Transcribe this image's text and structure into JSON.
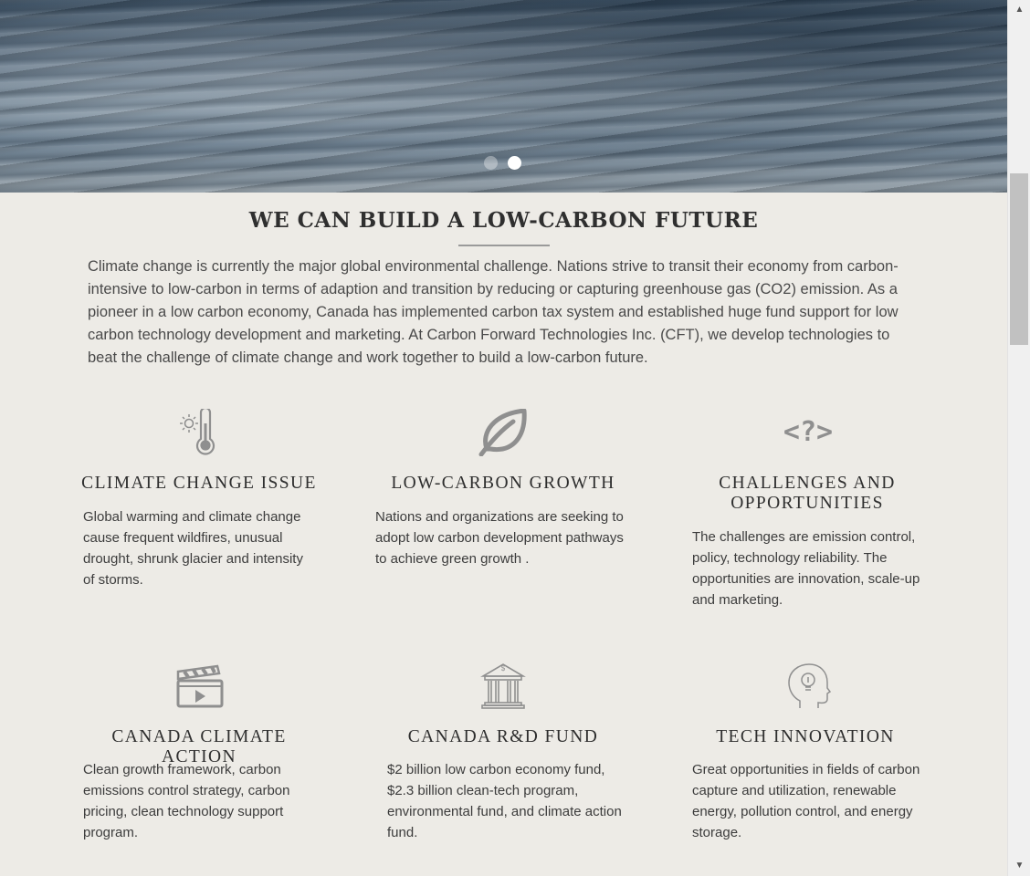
{
  "hero": {
    "slide_count": 2,
    "active_slide": 2
  },
  "section": {
    "title": "WE CAN BUILD A  LOW-CARBON FUTURE",
    "intro": "Climate change is currently the major global environmental challenge. Nations strive to transit their economy from carbon-intensive to low-carbon in terms of adaption and transition by reducing or capturing greenhouse gas (CO2) emission. As a pioneer in a low carbon economy, Canada has implemented carbon tax system and established huge fund support for low carbon technology development and marketing. At Carbon Forward Technologies Inc. (CFT), we develop technologies to beat the challenge of climate change and work together to build a low-carbon future."
  },
  "features": [
    {
      "icon": "thermometer-sun-icon",
      "title": "CLIMATE CHANGE ISSUE",
      "text": "Global warming and climate change cause frequent wildfires, unusual drought,  shrunk glacier and intensity of storms."
    },
    {
      "icon": "leaf-icon",
      "title": "LOW-CARBON GROWTH",
      "text": "Nations and organizations are seeking to adopt low carbon development pathways to achieve green growth ."
    },
    {
      "icon": "code-question-icon",
      "icon_text": "<?>",
      "title": "CHALLENGES AND OPPORTUNITIES",
      "text": "The challenges are emission control, policy, technology reliability. The opportunities are innovation, scale-up and marketing."
    },
    {
      "icon": "clapperboard-icon",
      "title": "CANADA CLIMATE ACTION",
      "text": "Clean growth framework, carbon emissions control strategy, carbon pricing,  clean technology support program."
    },
    {
      "icon": "bank-icon",
      "icon_text": "$",
      "title": "CANADA R&D FUND",
      "text": "$2 billion low carbon economy fund, $2.3 billion clean-tech program, environmental fund, and climate action fund."
    },
    {
      "icon": "head-lightbulb-icon",
      "title": "TECH INNOVATION",
      "text": "Great opportunities in fields of carbon capture and utilization, renewable energy, pollution control, and energy storage."
    }
  ],
  "colors": {
    "background": "#edebe6",
    "icon": "#8f8f8f",
    "text": "#3c3c3c"
  }
}
